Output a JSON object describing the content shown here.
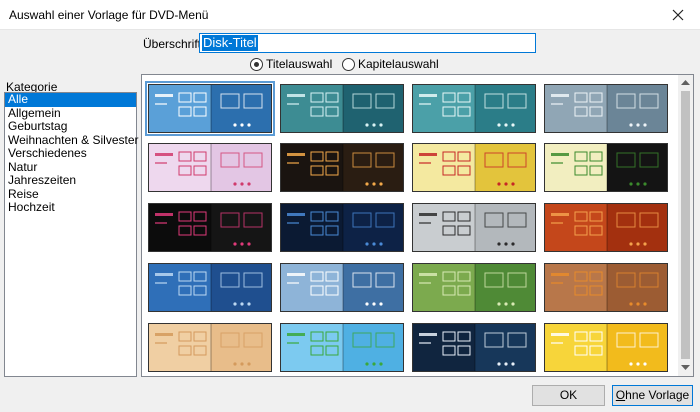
{
  "window": {
    "title": "Auswahl einer Vorlage für DVD-Menü"
  },
  "header": {
    "heading_label": "Überschrift:",
    "heading_value": "Disk-Titel",
    "radio_title": "Titelauswahl",
    "radio_chapter": "Kapitelauswahl",
    "selected_radio": "Titelauswahl"
  },
  "category": {
    "label": "Kategorie",
    "items": [
      "Alle",
      "Allgemein",
      "Geburtstag",
      "Weihnachten & Silvester",
      "Verschiedenes",
      "Natur",
      "Jahreszeiten",
      "Reise",
      "Hochzeit"
    ],
    "selected": "Alle"
  },
  "templates": {
    "selected_index": 0,
    "items": [
      {
        "name": "blue-frames",
        "left": "#5aa0d8",
        "right": "#2c6fae",
        "accent": "#ffffff"
      },
      {
        "name": "teal-frames",
        "left": "#3d8c93",
        "right": "#1f6270",
        "accent": "#d8f2f4"
      },
      {
        "name": "teal-sparkle",
        "left": "#4ba0a8",
        "right": "#2b7d88",
        "accent": "#e8f8f8"
      },
      {
        "name": "slate-frames",
        "left": "#90a6b5",
        "right": "#6b8597",
        "accent": "#eef4f8"
      },
      {
        "name": "party-balloons",
        "left": "#eed8ee",
        "right": "#e3c6e4",
        "accent": "#d03a6c"
      },
      {
        "name": "birthday-cake",
        "left": "#1a1410",
        "right": "#2a1d12",
        "accent": "#f3a94a"
      },
      {
        "name": "christmas-ornament",
        "left": "#f4e9a0",
        "right": "#e3c43c",
        "accent": "#c62626"
      },
      {
        "name": "christmas-tree-dark",
        "left": "#f2eec0",
        "right": "#141414",
        "accent": "#3b8a2c"
      },
      {
        "name": "fireworks",
        "left": "#0c0c0c",
        "right": "#151515",
        "accent": "#e03a7a"
      },
      {
        "name": "dark-swirl",
        "left": "#0b1a33",
        "right": "#0d2246",
        "accent": "#4a8ad6"
      },
      {
        "name": "penguin-grey",
        "left": "#c9cdd0",
        "right": "#b3b8bc",
        "accent": "#2b2b2b"
      },
      {
        "name": "sunset-clouds",
        "left": "#c4471b",
        "right": "#a3300f",
        "accent": "#f4a14c"
      },
      {
        "name": "blue-winter",
        "left": "#2f6fb8",
        "right": "#1f4f8f",
        "accent": "#bcd8f2"
      },
      {
        "name": "frosty-trees",
        "left": "#8eb4d8",
        "right": "#3e6fa3",
        "accent": "#ffffff"
      },
      {
        "name": "green-park",
        "left": "#7caa4e",
        "right": "#4f8a36",
        "accent": "#d8eab4"
      },
      {
        "name": "autumn-pumpkins",
        "left": "#b8774a",
        "right": "#9c5c33",
        "accent": "#e88b2a"
      },
      {
        "name": "parchment",
        "left": "#f0cfa3",
        "right": "#e8bd8a",
        "accent": "#d49a5c"
      },
      {
        "name": "cartoon-trees",
        "left": "#7ccaf0",
        "right": "#4fb0e3",
        "accent": "#3aa83a"
      },
      {
        "name": "dark-wave",
        "left": "#10253f",
        "right": "#17375a",
        "accent": "#e8f0f8"
      },
      {
        "name": "yellow-rays",
        "left": "#f7d53a",
        "right": "#f2bb1c",
        "accent": "#ffffff"
      }
    ]
  },
  "footer": {
    "ok_label": "OK",
    "none_label": "Ohne Vorlage"
  },
  "icons": {
    "close": "close-icon",
    "scroll_up": "scroll-up-arrow-icon",
    "scroll_down": "scroll-down-arrow-icon"
  }
}
